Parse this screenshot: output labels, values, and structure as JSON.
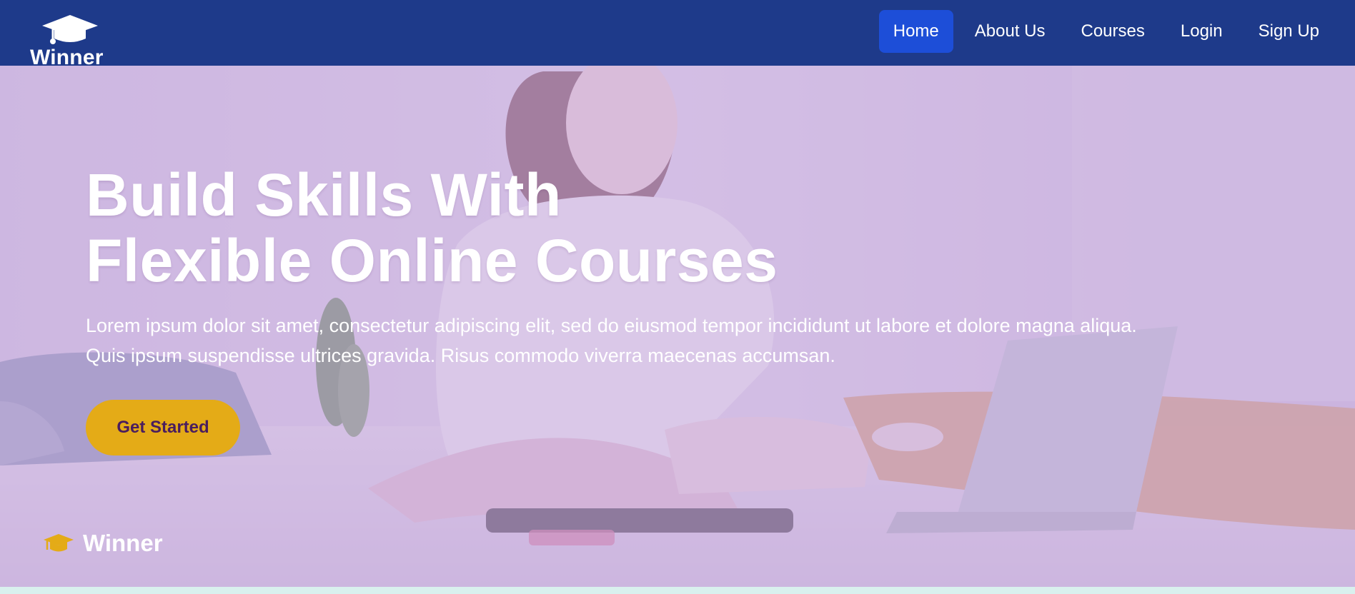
{
  "nav": {
    "brand": "Winner",
    "links": [
      {
        "label": "Home",
        "active": true
      },
      {
        "label": "About Us",
        "active": false
      },
      {
        "label": "Courses",
        "active": false
      },
      {
        "label": "Login",
        "active": false
      },
      {
        "label": "Sign Up",
        "active": false
      }
    ]
  },
  "hero": {
    "title_line1": "Build Skills With",
    "title_line2": "Flexible Online Courses",
    "description_line1": "Lorem ipsum dolor sit amet, consectetur adipiscing elit, sed do eiusmod tempor incididunt ut labore et dolore magna aliqua.",
    "description_line2": "Quis ipsum suspendisse ultrices gravida. Risus commodo viverra maecenas accumsan.",
    "cta_label": "Get Started",
    "background_icon": "woman-laptop-bed-photo"
  },
  "footer": {
    "brand": "Winner",
    "icon": "graduation-cap-icon"
  },
  "colors": {
    "navbar": "#1e3a8a",
    "active_nav": "#1d4ed8",
    "overlay": "#c4aadc",
    "cta": "#e4ab17",
    "cta_text": "#4a1d5e"
  }
}
